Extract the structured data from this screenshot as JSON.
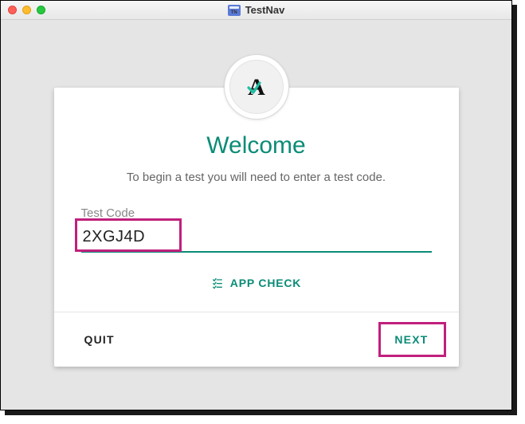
{
  "window": {
    "title": "TestNav"
  },
  "card": {
    "welcome": "Welcome",
    "subtitle": "To begin a test you will need to enter a test code.",
    "field_label": "Test Code",
    "field_value": "2XGJ4D",
    "app_check_label": "APP CHECK"
  },
  "footer": {
    "quit_label": "QUIT",
    "next_label": "NEXT"
  },
  "colors": {
    "accent": "#0a8c77",
    "highlight": "#c1207d"
  }
}
